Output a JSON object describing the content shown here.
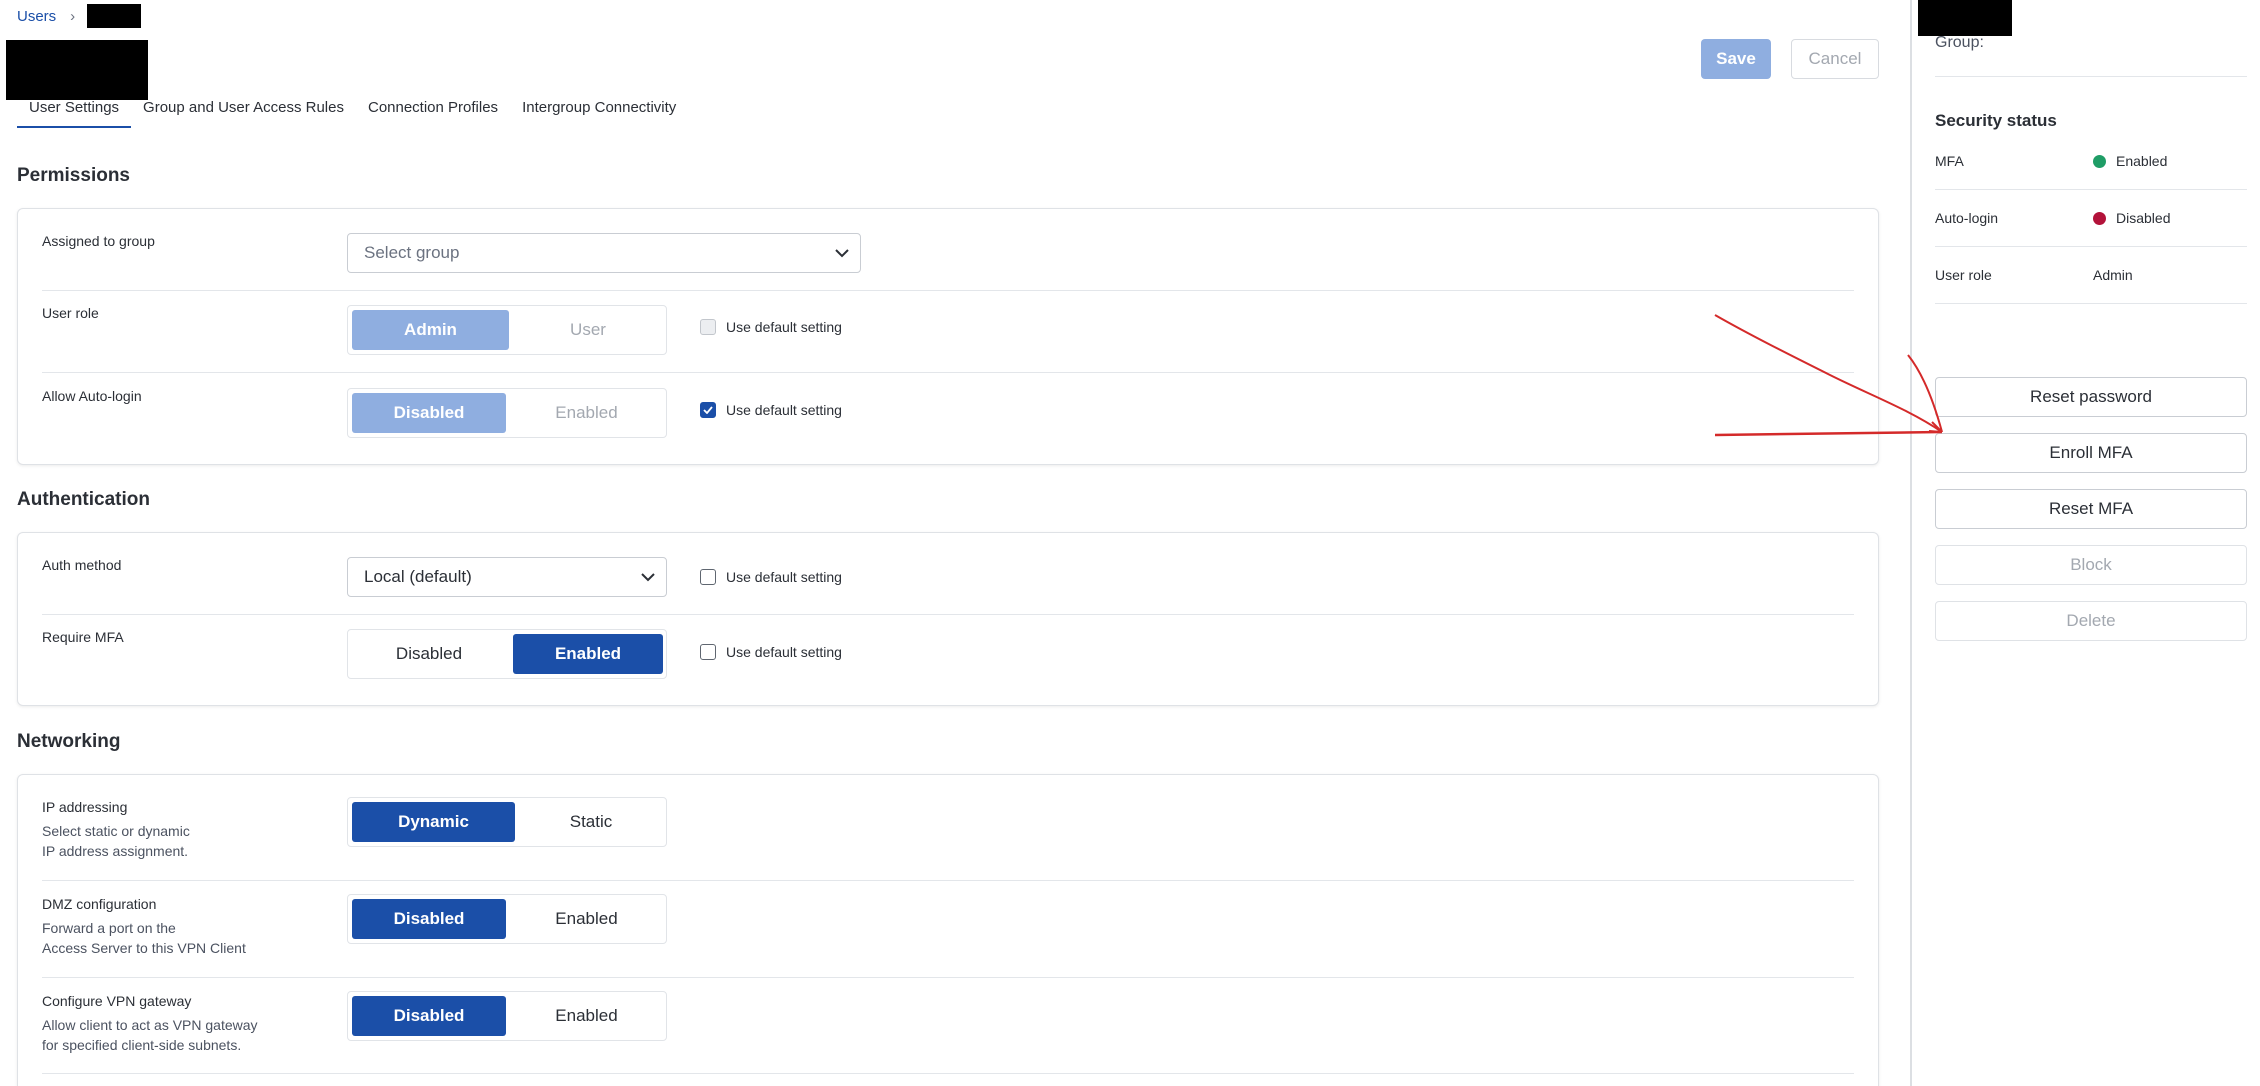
{
  "breadcrumb": {
    "root": "Users",
    "separator": "›"
  },
  "header": {
    "save": "Save",
    "cancel": "Cancel"
  },
  "tabs": [
    {
      "label": "User Settings",
      "active": true
    },
    {
      "label": "Group and User Access Rules"
    },
    {
      "label": "Connection Profiles"
    },
    {
      "label": "Intergroup Connectivity"
    }
  ],
  "permissions": {
    "title": "Permissions",
    "assigned_group": {
      "label": "Assigned to group",
      "placeholder": "Select group"
    },
    "user_role": {
      "label": "User role",
      "options": [
        "Admin",
        "User"
      ],
      "selected": "Admin",
      "default_label": "Use default setting",
      "default_checked": false
    },
    "auto_login": {
      "label": "Allow Auto-login",
      "options": [
        "Disabled",
        "Enabled"
      ],
      "selected": "Disabled",
      "default_label": "Use default setting",
      "default_checked": true
    }
  },
  "authentication": {
    "title": "Authentication",
    "auth_method": {
      "label": "Auth method",
      "value": "Local (default)",
      "default_label": "Use default setting",
      "default_checked": false
    },
    "require_mfa": {
      "label": "Require MFA",
      "options": [
        "Disabled",
        "Enabled"
      ],
      "selected": "Enabled",
      "default_label": "Use default setting",
      "default_checked": false
    }
  },
  "networking": {
    "title": "Networking",
    "ip_addressing": {
      "label": "IP addressing",
      "desc1": "Select static or dynamic",
      "desc2": "IP address assignment.",
      "options": [
        "Dynamic",
        "Static"
      ],
      "selected": "Dynamic"
    },
    "dmz": {
      "label": "DMZ configuration",
      "desc1": "Forward a port on the",
      "desc2": "Access Server to this VPN Client",
      "options": [
        "Disabled",
        "Enabled"
      ],
      "selected": "Disabled"
    },
    "vpn_gateway": {
      "label": "Configure VPN gateway",
      "desc1": "Allow client to act as VPN gateway",
      "desc2": "for specified client-side subnets.",
      "options": [
        "Disabled",
        "Enabled"
      ],
      "selected": "Disabled"
    }
  },
  "sidebar": {
    "group_label": "Group:",
    "security_title": "Security status",
    "status": [
      {
        "key": "MFA",
        "value": "Enabled",
        "color": "#1f9d66"
      },
      {
        "key": "Auto-login",
        "value": "Disabled",
        "color": "#b3123a"
      },
      {
        "key": "User role",
        "value": "Admin"
      }
    ],
    "actions": [
      {
        "label": "Reset password",
        "enabled": true
      },
      {
        "label": "Enroll MFA",
        "enabled": true
      },
      {
        "label": "Reset MFA",
        "enabled": true
      },
      {
        "label": "Block",
        "enabled": false
      },
      {
        "label": "Delete",
        "enabled": false
      }
    ]
  },
  "colors": {
    "accent": "#1b4fa8",
    "accent_dim": "#8faee0",
    "annotation": "#d42a2a"
  }
}
